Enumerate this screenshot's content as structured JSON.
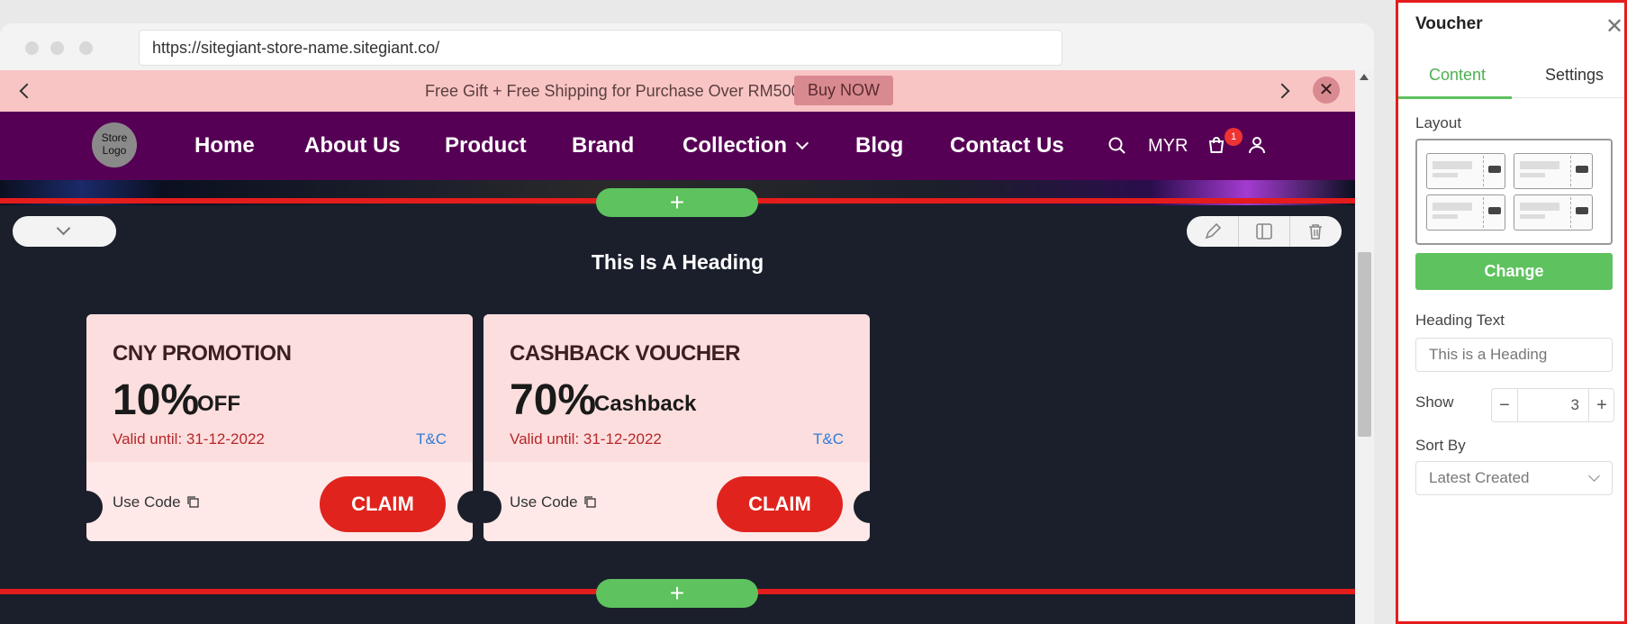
{
  "browser": {
    "url": "https://sitegiant-store-name.sitegiant.co/"
  },
  "announcement": {
    "text": "Free Gift + Free Shipping for Purchase Over RM500",
    "button": "Buy NOW",
    "close": "✕"
  },
  "nav": {
    "logo": "Store Logo",
    "items": [
      "Home",
      "About Us",
      "Product",
      "Brand",
      "Collection",
      "Blog",
      "Contact Us"
    ],
    "currency": "MYR",
    "cart_count": "1"
  },
  "section": {
    "add_symbol": "+",
    "heading": "This Is A Heading"
  },
  "vouchers": [
    {
      "title": "CNY PROMOTION",
      "amount": "10%",
      "unit": "OFF",
      "valid": "Valid until: 31-12-2022",
      "tc": "T&C",
      "code_label": "Use Code",
      "claim": "CLAIM"
    },
    {
      "title": "CASHBACK VOUCHER",
      "amount": "70%",
      "unit": "Cashback",
      "valid": "Valid until: 31-12-2022",
      "tc": "T&C",
      "code_label": "Use Code",
      "claim": "CLAIM"
    }
  ],
  "panel": {
    "title": "Voucher",
    "close": "✕",
    "tabs": [
      "Content",
      "Settings"
    ],
    "layout_label": "Layout",
    "change_button": "Change",
    "heading_label": "Heading Text",
    "heading_placeholder": "This is a Heading",
    "show_label": "Show",
    "show_value": "3",
    "minus": "−",
    "plus": "+",
    "sort_label": "Sort By",
    "sort_value": "Latest Created"
  },
  "colors": {
    "accent_green": "#5ec25e",
    "nav_purple": "#560055",
    "announce_pink": "#f9c4c4",
    "claim_red": "#e0231d",
    "highlight_red": "#e51c1c"
  }
}
